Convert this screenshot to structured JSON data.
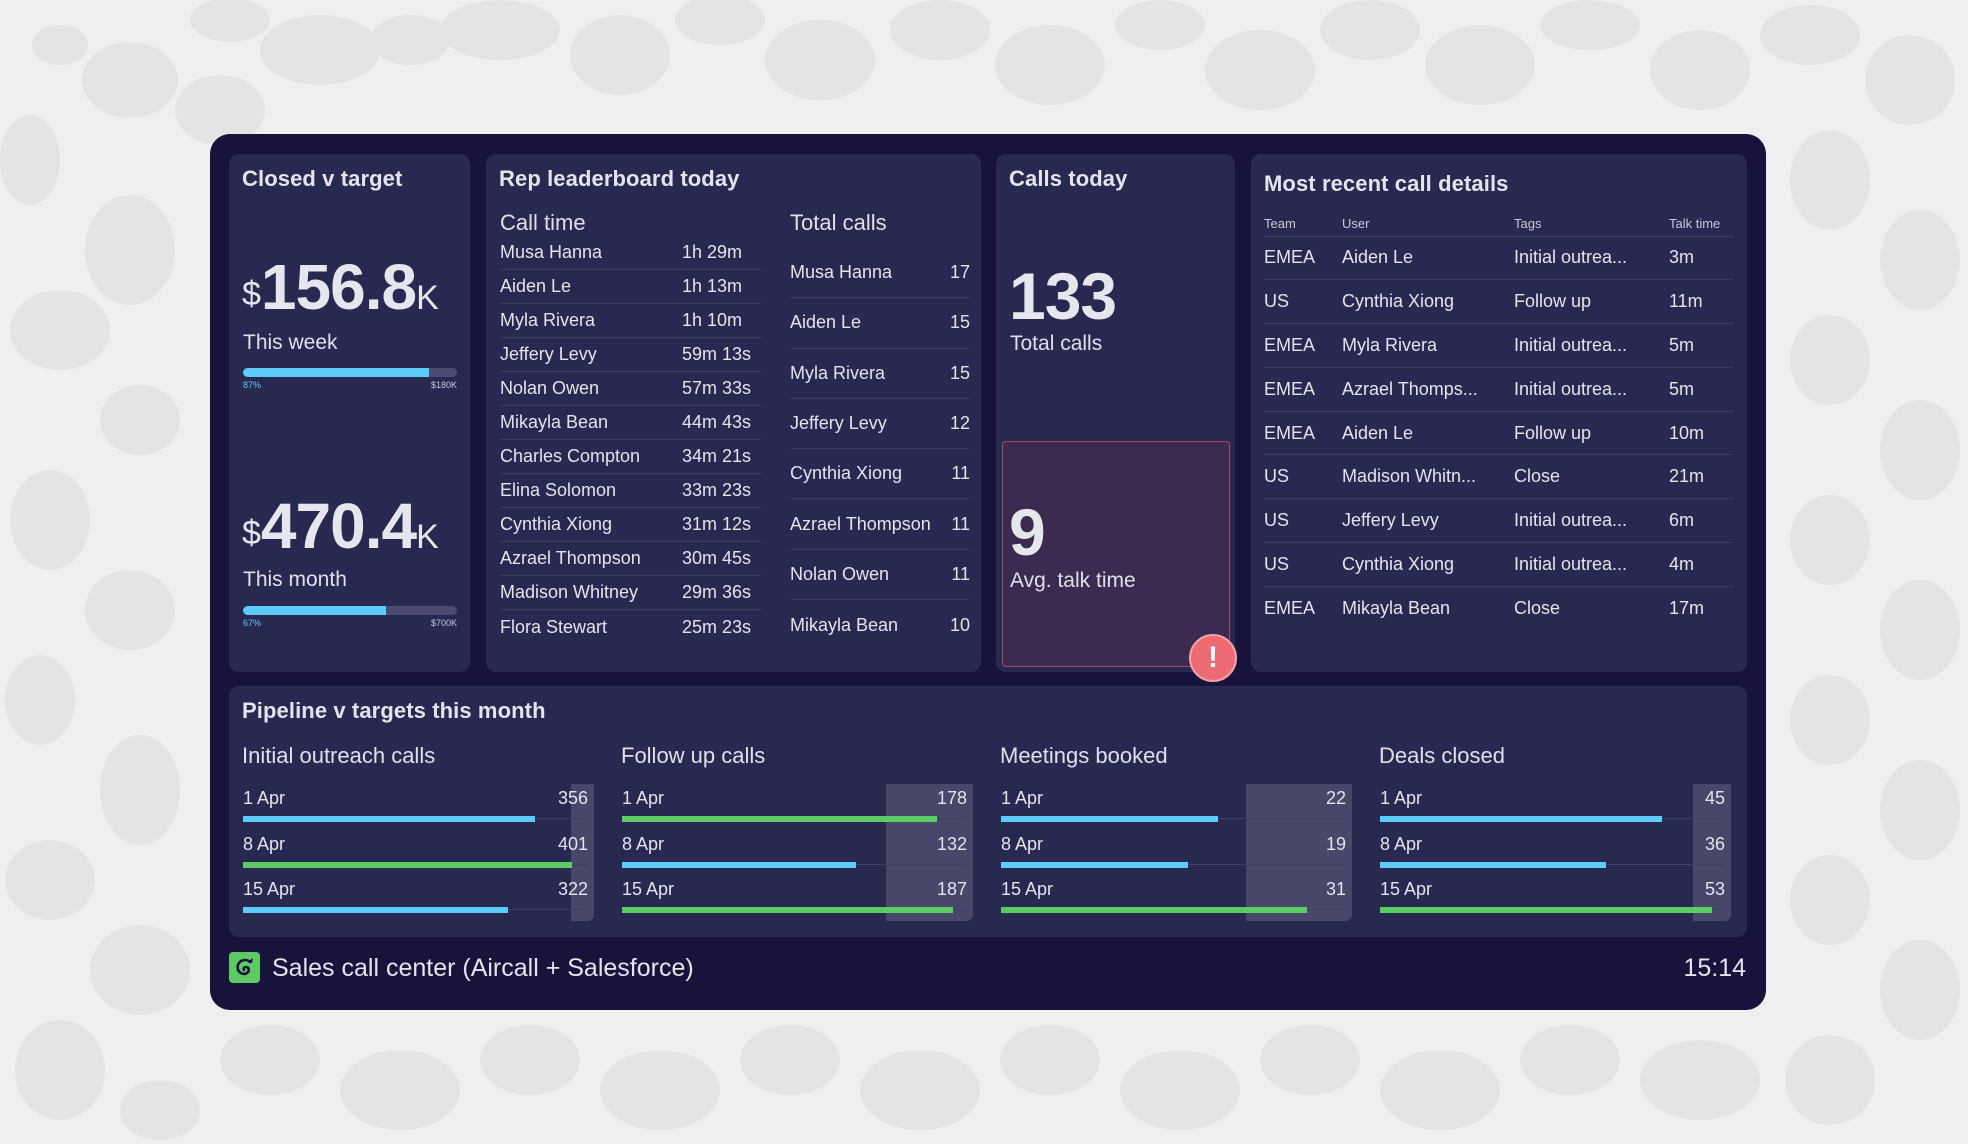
{
  "colors": {
    "page_bg": "#efefef",
    "frame_bg": "#17133b",
    "panel_bg": "#272950",
    "accent_blue": "#5ccbf8",
    "accent_green": "#5ccb63",
    "alert_red": "#ec6b72"
  },
  "closed": {
    "title": "Closed v target",
    "week": {
      "currency": "$",
      "value": "156.8",
      "suffix": "K",
      "label": "This week",
      "progress_percent": 87,
      "progress_label": "87%",
      "target_label": "$180K"
    },
    "month": {
      "currency": "$",
      "value": "470.4",
      "suffix": "K",
      "label": "This month",
      "progress_percent": 67,
      "progress_label": "67%",
      "target_label": "$700K"
    }
  },
  "leaderboard": {
    "title": "Rep leaderboard today",
    "call_time": {
      "title": "Call time",
      "rows": [
        {
          "name": "Musa Hanna",
          "value": "1h 29m"
        },
        {
          "name": "Aiden Le",
          "value": "1h 13m"
        },
        {
          "name": "Myla Rivera",
          "value": "1h 10m"
        },
        {
          "name": "Jeffery Levy",
          "value": "59m 13s"
        },
        {
          "name": "Nolan Owen",
          "value": "57m 33s"
        },
        {
          "name": "Mikayla Bean",
          "value": "44m 43s"
        },
        {
          "name": "Charles Compton",
          "value": "34m 21s"
        },
        {
          "name": "Elina Solomon",
          "value": "33m 23s"
        },
        {
          "name": "Cynthia Xiong",
          "value": "31m 12s"
        },
        {
          "name": "Azrael Thompson",
          "value": "30m 45s"
        },
        {
          "name": "Madison Whitney",
          "value": "29m 36s"
        },
        {
          "name": "Flora Stewart",
          "value": "25m 23s"
        }
      ]
    },
    "total_calls": {
      "title": "Total calls",
      "rows": [
        {
          "name": "Musa Hanna",
          "value": "17"
        },
        {
          "name": "Aiden Le",
          "value": "15"
        },
        {
          "name": "Myla Rivera",
          "value": "15"
        },
        {
          "name": "Jeffery Levy",
          "value": "12"
        },
        {
          "name": "Cynthia Xiong",
          "value": "11"
        },
        {
          "name": "Azrael Thompson",
          "value": "11"
        },
        {
          "name": "Nolan Owen",
          "value": "11"
        },
        {
          "name": "Mikayla Bean",
          "value": "10"
        }
      ]
    }
  },
  "calls_today": {
    "title": "Calls today",
    "total": {
      "value": "133",
      "label": "Total calls"
    },
    "avg_talk": {
      "value": "9",
      "label": "Avg. talk time",
      "alert_icon": "exclamation-icon",
      "alert_glyph": "!"
    }
  },
  "recent_calls": {
    "title": "Most recent call details",
    "columns": [
      "Team",
      "User",
      "Tags",
      "Talk time"
    ],
    "rows": [
      [
        "EMEA",
        "Aiden Le",
        "Initial outrea...",
        "3m"
      ],
      [
        "US",
        "Cynthia Xiong",
        "Follow up",
        "11m"
      ],
      [
        "EMEA",
        "Myla Rivera",
        "Initial outrea...",
        "5m"
      ],
      [
        "EMEA",
        "Azrael Thomps...",
        "Initial outrea...",
        "5m"
      ],
      [
        "EMEA",
        "Aiden Le",
        "Follow up",
        "10m"
      ],
      [
        "US",
        "Madison Whitn...",
        "Close",
        "21m"
      ],
      [
        "US",
        "Jeffery Levy",
        "Initial outrea...",
        "6m"
      ],
      [
        "US",
        "Cynthia Xiong",
        "Initial outrea...",
        "4m"
      ],
      [
        "EMEA",
        "Mikayla Bean",
        "Close",
        "17m"
      ]
    ]
  },
  "pipeline": {
    "title": "Pipeline v targets this month",
    "groups": [
      {
        "title": "Initial outreach calls",
        "target_range": [
          400,
          420
        ],
        "axis_max": 420,
        "rows": [
          {
            "label": "1 Apr",
            "value": 356,
            "display": "356",
            "met_target": false
          },
          {
            "label": "8 Apr",
            "value": 401,
            "display": "401",
            "met_target": true
          },
          {
            "label": "15 Apr",
            "value": 322,
            "display": "322",
            "met_target": false
          }
        ]
      },
      {
        "title": "Follow up calls",
        "target_range": [
          150,
          200
        ],
        "axis_max": 195,
        "rows": [
          {
            "label": "1 Apr",
            "value": 178,
            "display": "178",
            "met_target": true
          },
          {
            "label": "8 Apr",
            "value": 132,
            "display": "132",
            "met_target": false
          },
          {
            "label": "15 Apr",
            "value": 187,
            "display": "187",
            "met_target": true
          }
        ]
      },
      {
        "title": "Meetings booked",
        "target_range": [
          25,
          35
        ],
        "axis_max": 35,
        "rows": [
          {
            "label": "1 Apr",
            "value": 22,
            "display": "22",
            "met_target": false
          },
          {
            "label": "8 Apr",
            "value": 19,
            "display": "19",
            "met_target": false
          },
          {
            "label": "15 Apr",
            "value": 31,
            "display": "31",
            "met_target": true
          }
        ]
      },
      {
        "title": "Deals closed",
        "target_range": [
          50,
          55
        ],
        "axis_max": 55,
        "rows": [
          {
            "label": "1 Apr",
            "value": 45,
            "display": "45",
            "met_target": false
          },
          {
            "label": "8 Apr",
            "value": 36,
            "display": "36",
            "met_target": false
          },
          {
            "label": "15 Apr",
            "value": 53,
            "display": "53",
            "met_target": true
          }
        ]
      }
    ]
  },
  "footer": {
    "logo_icon": "aircall-logo-icon",
    "title": "Sales call center (Aircall + Salesforce)",
    "clock": "15:14"
  }
}
